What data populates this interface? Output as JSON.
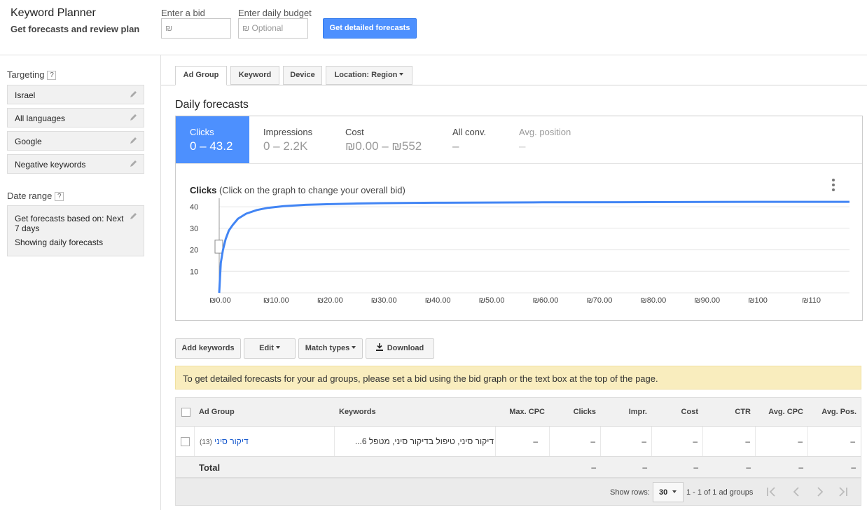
{
  "header": {
    "title": "Keyword Planner",
    "subtitle": "Get forecasts and review plan",
    "bid_label": "Enter a bid",
    "bid_placeholder": "₪",
    "budget_label": "Enter daily budget",
    "budget_placeholder": "₪  Optional",
    "forecast_button": "Get detailed forecasts"
  },
  "sidebar": {
    "targeting_label": "Targeting",
    "help": "?",
    "targeting_items": [
      "Israel",
      "All languages",
      "Google",
      "Negative keywords"
    ],
    "date_range_label": "Date range",
    "date_line1": "Get forecasts based on: Next 7 days",
    "date_line2": "Showing daily forecasts"
  },
  "tabs": [
    {
      "label": "Ad Group",
      "active": true
    },
    {
      "label": "Keyword",
      "active": false
    },
    {
      "label": "Device",
      "active": false
    },
    {
      "label": "Location: Region",
      "active": false
    }
  ],
  "forecasts": {
    "title": "Daily forecasts",
    "metrics": [
      {
        "label": "Clicks",
        "value": "0 – 43.2",
        "active": true
      },
      {
        "label": "Impressions",
        "value": "0 – 2.2K",
        "active": false
      },
      {
        "label": "Cost",
        "value": "₪0.00 – ₪552",
        "active": false
      },
      {
        "label": "All conv.",
        "value": "–",
        "active": false
      },
      {
        "label": "Avg. position",
        "value": "–",
        "active": false
      }
    ],
    "chart_title_bold": "Clicks",
    "chart_title_rest": "(Click on the graph to change your overall bid)"
  },
  "chart_data": {
    "type": "line",
    "title": "Clicks",
    "xlabel": "",
    "ylabel": "",
    "x_ticks": [
      "₪0.00",
      "₪10.00",
      "₪20.00",
      "₪30.00",
      "₪40.00",
      "₪50.00",
      "₪60.00",
      "₪70.00",
      "₪80.00",
      "₪90.00",
      "₪100",
      "₪110"
    ],
    "y_ticks": [
      10,
      20,
      30,
      40
    ],
    "xlim": [
      0,
      117
    ],
    "ylim": [
      0,
      43
    ],
    "x": [
      0,
      0.3,
      0.7,
      1.2,
      1.8,
      2.5,
      3.5,
      5,
      7,
      9,
      12,
      16,
      20,
      25,
      30,
      40,
      50,
      60,
      80,
      100,
      117
    ],
    "y": [
      0,
      14,
      20,
      25,
      29,
      31.5,
      34.5,
      36.8,
      38.5,
      39.5,
      40.3,
      40.9,
      41.2,
      41.5,
      41.7,
      41.9,
      42.0,
      42.1,
      42.2,
      42.3,
      42.3
    ],
    "selected_bid_x": 0,
    "selected_bid_range_y": [
      18.5,
      24.5
    ],
    "line_color": "#4285f4",
    "grid": true
  },
  "toolbar": {
    "add_keywords": "Add keywords",
    "edit": "Edit",
    "match_types": "Match types",
    "download": "Download"
  },
  "notice": "To get detailed forecasts for your ad groups, please set a bid using the bid graph or the text box at the top of the page.",
  "table": {
    "columns": [
      "Ad Group",
      "Keywords",
      "Max. CPC",
      "Clicks",
      "Impr.",
      "Cost",
      "CTR",
      "Avg. CPC",
      "Avg. Pos."
    ],
    "rows": [
      {
        "ad_group": "דיקור סיני",
        "ad_group_count": "(13)",
        "keywords": "דיקור סיני, טיפול בדיקור סיני, מטפל 6...",
        "values": [
          "–",
          "–",
          "–",
          "–",
          "–",
          "–",
          "–"
        ]
      }
    ],
    "total_label": "Total",
    "total_values": [
      "–",
      "–",
      "–",
      "–",
      "–",
      "–"
    ]
  },
  "pager": {
    "show_rows_label": "Show rows:",
    "rows_value": "30",
    "range_text": "1 - 1 of 1 ad groups"
  }
}
